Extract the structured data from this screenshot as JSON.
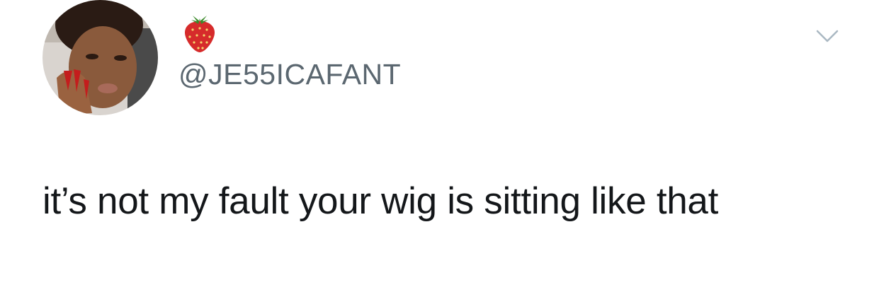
{
  "tweet": {
    "display_name_icon": "strawberry-emoji",
    "handle": "@JE55ICAFANT",
    "text": "it’s not my fault your wig is sitting like that",
    "menu_icon": "chevron-down-icon"
  },
  "colors": {
    "handle": "#5b6770",
    "text": "#14171a",
    "chevron": "#aab8c2",
    "strawberry": "#d62b2b"
  }
}
